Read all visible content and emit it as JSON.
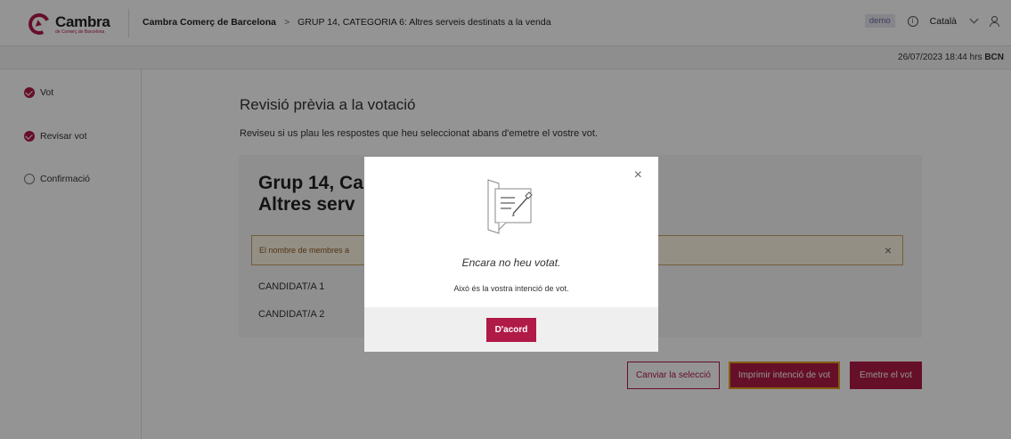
{
  "header": {
    "logo_name": "Cambra",
    "logo_sub": "de Comerç de Barcelona",
    "breadcrumb_root": "Cambra Comerç de Barcelona",
    "breadcrumb_sep": ">",
    "breadcrumb_current": "GRUP 14, CATEGORIA 6: Altres serveis destinats a la venda",
    "badge": "demo",
    "info_glyph": "i",
    "language": "Català"
  },
  "datebar": {
    "datetime": "26/07/2023 18:44 hrs",
    "city": "BCN"
  },
  "sidebar": {
    "steps": [
      {
        "label": "Vot",
        "status": "done"
      },
      {
        "label": "Revisar vot",
        "status": "done"
      },
      {
        "label": "Confirmació",
        "status": "pending"
      }
    ]
  },
  "main": {
    "title": "Revisió prèvia a la votació",
    "description": "Reviseu si us plau les respostes que heu seleccionat abans d'emetre el vostre vot.",
    "card": {
      "title_line1": "Grup 14, Ca",
      "title_line2": "Altres serv",
      "alert": "El nombre de membres a",
      "alert_close": "×",
      "candidates": [
        "CANDIDAT/A 1",
        "CANDIDAT/A 2"
      ]
    },
    "buttons": {
      "change": "Canviar la selecció",
      "print": "Imprimir intenció de vot",
      "emit": "Emetre el vot"
    }
  },
  "modal": {
    "close": "×",
    "title": "Encara no heu votat.",
    "text": "Això és la vostra intenció de vot.",
    "ok": "D'acord"
  },
  "colors": {
    "brand": "#b01a47",
    "print_border": "#e0a020",
    "alert_bg": "#fdf6e6"
  },
  "icons": {
    "logo": "cambra-logo-icon",
    "info": "info-icon",
    "dropdown": "chevron-down-icon",
    "user": "user-icon",
    "modal": "ballot-edit-icon"
  }
}
